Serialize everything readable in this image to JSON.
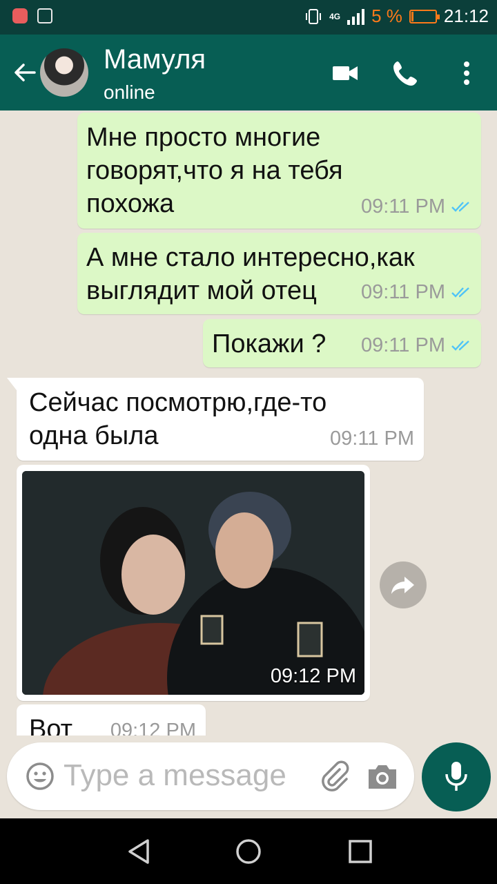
{
  "status_bar": {
    "network": "4G",
    "battery_percent": "5 %",
    "battery_level": 0.05,
    "time": "21:12",
    "icons": [
      "notification-app-icon",
      "image-icon",
      "vibrate-icon",
      "signal-icon",
      "battery-icon"
    ]
  },
  "header": {
    "contact_name": "Мамуля",
    "status": "online",
    "icons": [
      "back-arrow-icon",
      "avatar",
      "video-call-icon",
      "phone-icon",
      "more-options-icon"
    ]
  },
  "messages": [
    {
      "direction": "outgoing",
      "text": "Мне просто многие\nговорят,что я на тебя\nпохожа",
      "time": "09:11 PM",
      "status": "read"
    },
    {
      "direction": "outgoing",
      "text": "А мне стало интересно,как\nвыглядит мой отец",
      "time": "09:11 PM",
      "status": "read"
    },
    {
      "direction": "outgoing",
      "text": "Покажи ?",
      "time": "09:11 PM",
      "status": "read"
    },
    {
      "direction": "incoming",
      "text": "Сейчас посмотрю,где-то\nодна была",
      "time": "09:11 PM"
    },
    {
      "direction": "incoming",
      "type": "photo",
      "time": "09:12 PM"
    },
    {
      "direction": "incoming",
      "text": "Вот",
      "time": "09:12 PM"
    }
  ],
  "composer": {
    "placeholder": "Type a message",
    "icons": [
      "emoji-icon",
      "attach-icon",
      "camera-icon",
      "mic-icon"
    ]
  },
  "colors": {
    "header": "#075e54",
    "status_bar": "#0b3f3a",
    "outgoing_bubble": "#dcf8c6",
    "incoming_bubble": "#ffffff",
    "read_ticks": "#4fc3f7",
    "chat_background": "#e9e3da"
  }
}
